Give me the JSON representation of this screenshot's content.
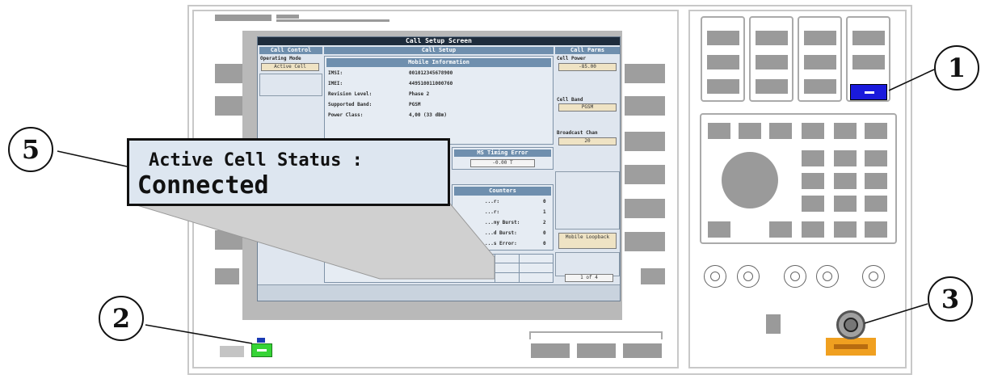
{
  "screen": {
    "title": "Call Setup Screen",
    "call_control": {
      "header": "Call Control",
      "operating_mode_label": "Operating Mode",
      "operating_mode_value": "Active Cell"
    },
    "call_setup": {
      "header": "Call Setup",
      "mobile_info_header": "Mobile Information",
      "rows": [
        {
          "label": "IMSI:",
          "value": "001012345678900"
        },
        {
          "label": "IMEI:",
          "value": "449510011000760"
        },
        {
          "label": "Revision Level:",
          "value": "Phase 2"
        },
        {
          "label": "Supported Band:",
          "value": "PGSM"
        },
        {
          "label": "Power Class:",
          "value": "4,00  (33 dBm)"
        }
      ],
      "timing_error_header": "MS Timing Error",
      "timing_error_value": "-0.00 T",
      "counters_header": "Counters",
      "counter_rows": [
        {
          "label": "...r:",
          "value": "0"
        },
        {
          "label": "...r:",
          "value": "1"
        },
        {
          "label": "...ny Burst:",
          "value": "2"
        },
        {
          "label": "...d Burst:",
          "value": "0"
        },
        {
          "label": "...s Error:",
          "value": "0"
        }
      ]
    },
    "call_parms": {
      "header": "Call Parms",
      "cell_power_label": "Cell Power",
      "cell_power_value": "-85.00",
      "cell_band_label": "Cell Band",
      "cell_band_value": "PGSM",
      "broadcast_chan_label": "Broadcast Chan",
      "broadcast_chan_value": "20",
      "mobile_loopback_label": "Mobile Loopback",
      "page_indicator": "1 of 4"
    }
  },
  "callout": {
    "line1": "Active Cell Status :",
    "line2": "Connected"
  },
  "markers": [
    "1",
    "2",
    "3",
    "5"
  ],
  "colors": {
    "marker1_key": "#1a1adc",
    "marker2_key": "#36d436",
    "marker2_tab": "#1a3ab4",
    "marker3_label": "#f0a020",
    "screen_bg": "#dfe6ef",
    "header_bg": "#6f8fae"
  }
}
